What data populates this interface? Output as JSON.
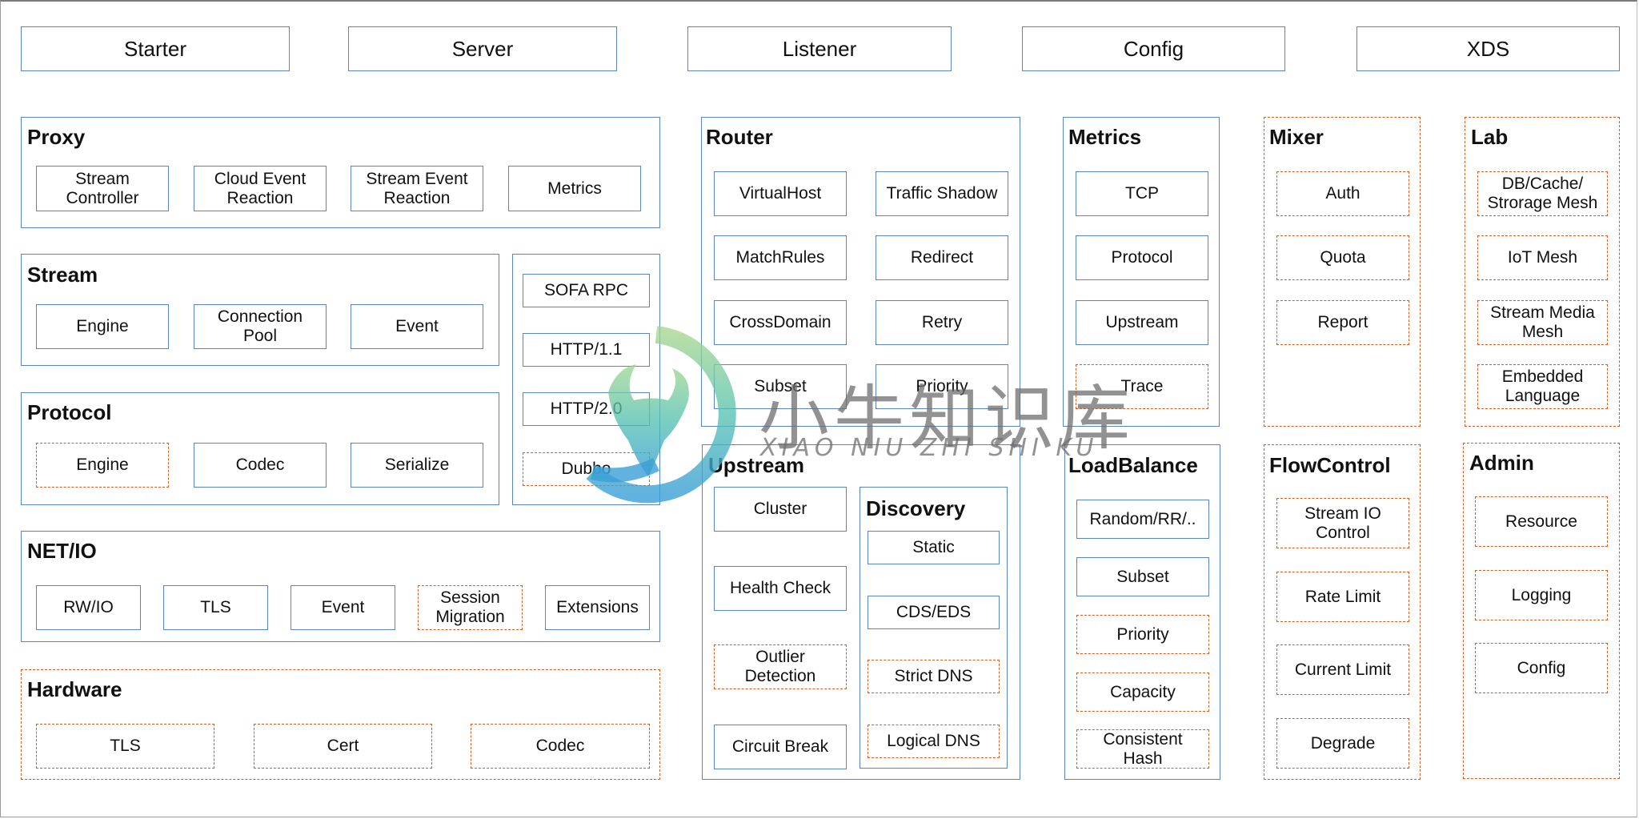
{
  "colors": {
    "solid_border": "#5b84b8",
    "dashed_border": "#c8602a",
    "text": "#111111"
  },
  "top_row": [
    "Starter",
    "Server",
    "Listener",
    "Config",
    "XDS"
  ],
  "proxy": {
    "title": "Proxy",
    "items": [
      "Stream\nController",
      "Cloud Event\nReaction",
      "Stream Event\nReaction",
      "Metrics"
    ]
  },
  "stream": {
    "title": "Stream",
    "items": [
      "Engine",
      "Connection\nPool",
      "Event"
    ]
  },
  "protocols_list": {
    "items": [
      "SOFA RPC",
      "HTTP/1.1",
      "HTTP/2.0",
      "Dubbo"
    ]
  },
  "protocol": {
    "title": "Protocol",
    "items": [
      "Engine",
      "Codec",
      "Serialize"
    ]
  },
  "netio": {
    "title": "NET/IO",
    "items": [
      "RW/IO",
      "TLS",
      "Event",
      "Session\nMigration",
      "Extensions"
    ]
  },
  "hardware": {
    "title": "Hardware",
    "items": [
      "TLS",
      "Cert",
      "Codec"
    ]
  },
  "router": {
    "title": "Router",
    "items": [
      "VirtualHost",
      "Traffic Shadow",
      "MatchRules",
      "Redirect",
      "CrossDomain",
      "Retry",
      "Subset",
      "Priority"
    ]
  },
  "upstream": {
    "title": "Upstream",
    "items": [
      "Cluster",
      "Health Check",
      "Outlier\nDetection",
      "Circuit Break"
    ],
    "discovery": {
      "title": "Discovery",
      "items": [
        "Static",
        "CDS/EDS",
        "Strict DNS",
        "Logical DNS"
      ]
    }
  },
  "metrics": {
    "title": "Metrics",
    "items": [
      "TCP",
      "Protocol",
      "Upstream",
      "Trace"
    ]
  },
  "loadbalance": {
    "title": "LoadBalance",
    "items": [
      "Random/RR/..",
      "Subset",
      "Priority",
      "Capacity",
      "Consistent\nHash"
    ]
  },
  "mixer": {
    "title": "Mixer",
    "items": [
      "Auth",
      "Quota",
      "Report"
    ]
  },
  "flowcontrol": {
    "title": "FlowControl",
    "items": [
      "Stream IO\nControl",
      "Rate Limit",
      "Current Limit",
      "Degrade"
    ]
  },
  "lab": {
    "title": "Lab",
    "items": [
      "DB/Cache/\nStrorage Mesh",
      "IoT Mesh",
      "Stream Media\nMesh",
      "Embedded\nLanguage"
    ]
  },
  "admin": {
    "title": "Admin",
    "items": [
      "Resource",
      "Logging",
      "Config"
    ]
  },
  "watermark": {
    "cn_text": "小牛知识库",
    "en_text": "XIAO NIU ZHI SHI KU"
  }
}
